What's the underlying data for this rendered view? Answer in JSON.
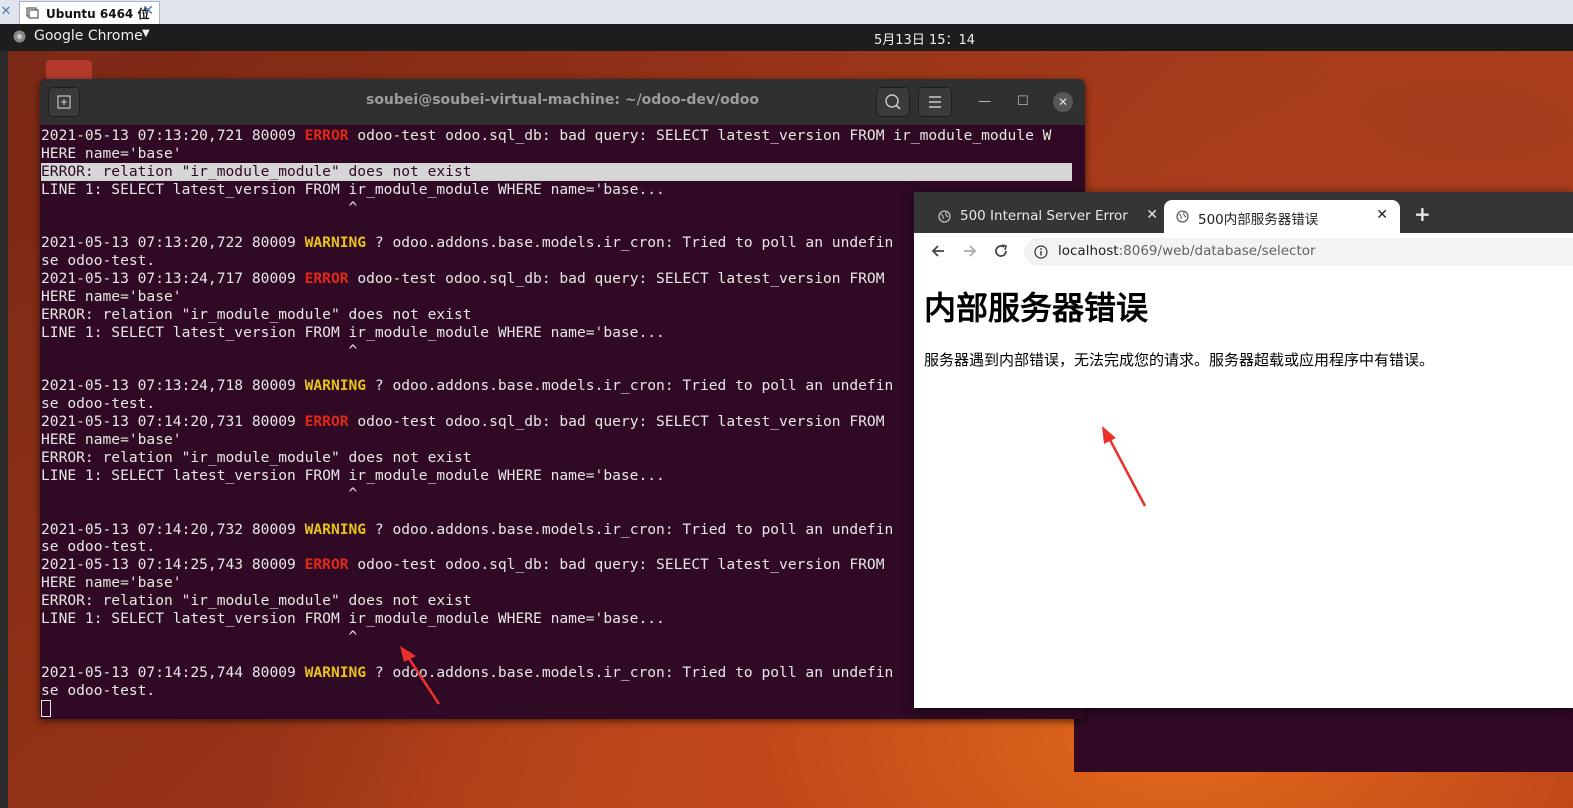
{
  "vm": {
    "tab_label": "Ubuntu 6464 位"
  },
  "topbar": {
    "app_name": "Google Chrome",
    "clock": "5月13日  15：14"
  },
  "terminal": {
    "title": "soubei@soubei-virtual-machine: ~/odoo-dev/odoo",
    "lines": [
      {
        "pre": "2021-05-13 07:13:20,721 80009 ",
        "kw": "ERROR",
        "post": " odoo-test odoo.sql_db: bad query: SELECT latest_version FROM ir_module_module W"
      },
      {
        "pre": "HERE name='base'"
      },
      {
        "pre": "ERROR: relation \"ir_module_module\" does not exist",
        "highlight": true
      },
      {
        "pre": "LINE 1: SELECT latest_version FROM ir_module_module WHERE name='base..."
      },
      {
        "pre": "                                   ^"
      },
      {
        "pre": ""
      },
      {
        "pre": "2021-05-13 07:13:20,722 80009 ",
        "kw": "WARNING",
        "post": " ? odoo.addons.base.models.ir_cron: Tried to poll an undefin"
      },
      {
        "pre": "se odoo-test."
      },
      {
        "pre": "2021-05-13 07:13:24,717 80009 ",
        "kw": "ERROR",
        "post": " odoo-test odoo.sql_db: bad query: SELECT latest_version FROM"
      },
      {
        "pre": "HERE name='base'"
      },
      {
        "pre": "ERROR: relation \"ir_module_module\" does not exist"
      },
      {
        "pre": "LINE 1: SELECT latest_version FROM ir_module_module WHERE name='base..."
      },
      {
        "pre": "                                   ^"
      },
      {
        "pre": ""
      },
      {
        "pre": "2021-05-13 07:13:24,718 80009 ",
        "kw": "WARNING",
        "post": " ? odoo.addons.base.models.ir_cron: Tried to poll an undefin"
      },
      {
        "pre": "se odoo-test."
      },
      {
        "pre": "2021-05-13 07:14:20,731 80009 ",
        "kw": "ERROR",
        "post": " odoo-test odoo.sql_db: bad query: SELECT latest_version FROM"
      },
      {
        "pre": "HERE name='base'"
      },
      {
        "pre": "ERROR: relation \"ir_module_module\" does not exist"
      },
      {
        "pre": "LINE 1: SELECT latest_version FROM ir_module_module WHERE name='base..."
      },
      {
        "pre": "                                   ^"
      },
      {
        "pre": ""
      },
      {
        "pre": "2021-05-13 07:14:20,732 80009 ",
        "kw": "WARNING",
        "post": " ? odoo.addons.base.models.ir_cron: Tried to poll an undefin"
      },
      {
        "pre": "se odoo-test."
      },
      {
        "pre": "2021-05-13 07:14:25,743 80009 ",
        "kw": "ERROR",
        "post": " odoo-test odoo.sql_db: bad query: SELECT latest_version FROM"
      },
      {
        "pre": "HERE name='base'"
      },
      {
        "pre": "ERROR: relation \"ir_module_module\" does not exist"
      },
      {
        "pre": "LINE 1: SELECT latest_version FROM ir_module_module WHERE name='base..."
      },
      {
        "pre": "                                   ^"
      },
      {
        "pre": ""
      },
      {
        "pre": "2021-05-13 07:14:25,744 80009 ",
        "kw": "WARNING",
        "post": " ? odoo.addons.base.models.ir_cron: Tried to poll an undefin"
      },
      {
        "pre": "se odoo-test."
      }
    ]
  },
  "browser": {
    "tabs": [
      {
        "label": "500 Internal Server Error"
      },
      {
        "label": "500内部服务器错误"
      }
    ],
    "url_host": "localhost",
    "url_rest": ":8069/web/database/selector",
    "page_heading": "内部服务器错误",
    "page_text": "服务器遇到内部错误，无法完成您的请求。服务器超载或应用程序中有错误。"
  },
  "colors": {
    "terminal_bg": "#300a24",
    "error": "#e0281a",
    "warning": "#e8c21a",
    "annotation_arrow": "#e8312a"
  }
}
